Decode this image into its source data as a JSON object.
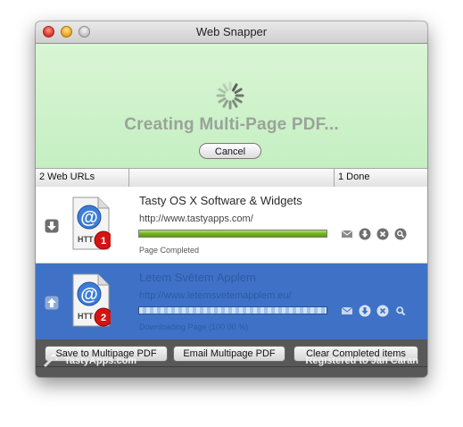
{
  "window": {
    "title": "Web Snapper"
  },
  "banner": {
    "message": "Creating Multi-Page PDF...",
    "cancel_label": "Cancel"
  },
  "header": {
    "urls_count": "2 Web URLs",
    "done_count": "1 Done"
  },
  "items": [
    {
      "badge": "1",
      "doc_label": "HTT",
      "title": "Tasty OS X Software & Widgets",
      "url": "http://www.tastyapps.com/",
      "status": "Page Completed",
      "progress": 1.0,
      "state": "completed"
    },
    {
      "badge": "2",
      "doc_label": "HTT",
      "title": "Letem Světem Applem",
      "url": "http://www.letemsvetemapplem.eu/",
      "status": "Downloading Page (100.00 %)",
      "progress": 1.0,
      "state": "downloading"
    }
  ],
  "footer": {
    "save_label": "Save to Multipage PDF",
    "email_label": "Email Multipage PDF",
    "clear_label": "Clear Completed items",
    "brand": "TastyApps.com",
    "registered": "Registered to Jan Caran"
  },
  "colors": {
    "banner_bg": "#c5efc2",
    "selected_row": "#3f72c6",
    "progress_green": "#7cbd2a",
    "progress_blue": "#a8cdf5"
  },
  "icons": {
    "spinner": "spinner-icon",
    "row_arrows": [
      "down-arrow-icon",
      "up-arrow-icon"
    ],
    "actions": [
      "mail-icon",
      "download-icon",
      "remove-icon",
      "magnifier-icon"
    ],
    "brand": "wand-icon"
  }
}
